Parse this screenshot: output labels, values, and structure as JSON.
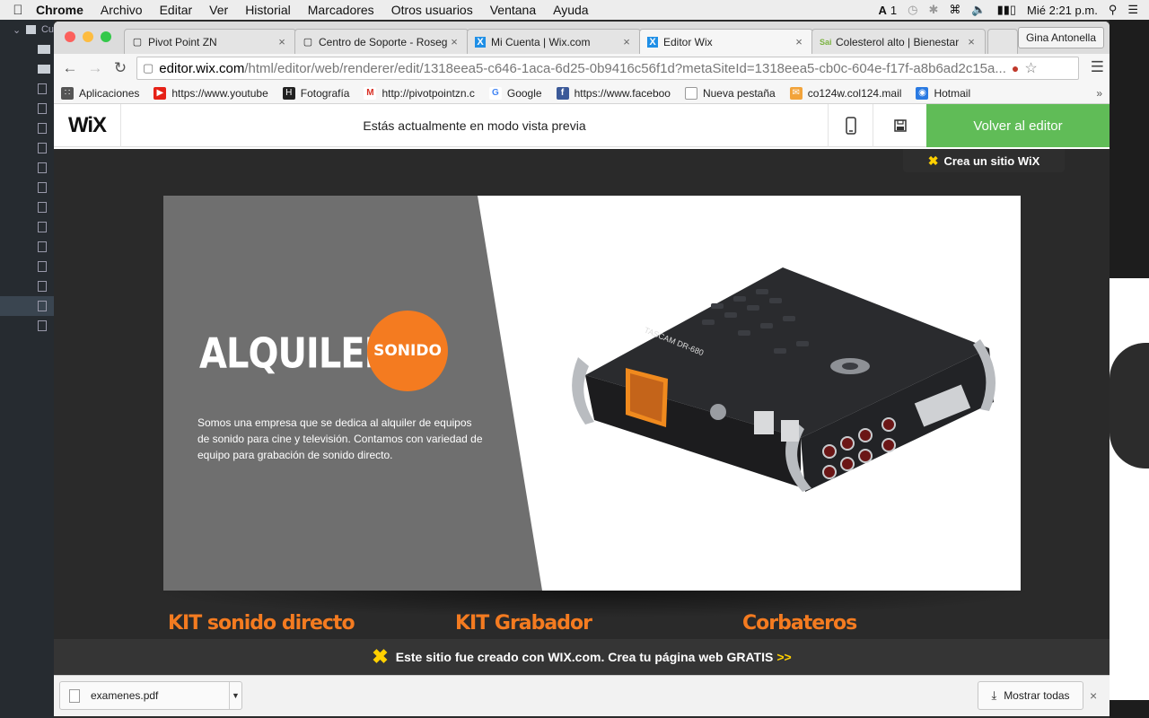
{
  "menubar": {
    "app": "Chrome",
    "items": [
      "Archivo",
      "Editar",
      "Ver",
      "Historial",
      "Marcadores",
      "Otros usuarios",
      "Ventana",
      "Ayuda"
    ],
    "status_a": "1",
    "clock": "Mié 2:21 p.m."
  },
  "sidebar_label": "Cu",
  "tabs": [
    {
      "title": "Pivot Point ZN",
      "icon": "page-icon"
    },
    {
      "title": "Centro de Soporte - Roseg",
      "icon": "page-icon"
    },
    {
      "title": "Mi Cuenta | Wix.com",
      "icon": "wix-icon"
    },
    {
      "title": "Editor Wix",
      "icon": "wix-icon",
      "active": true
    },
    {
      "title": "Colesterol alto | Bienestar",
      "icon": "sai-icon"
    }
  ],
  "profile": "Gina Antonella",
  "omnibox": {
    "host": "editor.wix.com",
    "path": "/html/editor/web/renderer/edit/1318eea5-c646-1aca-6d25-0b9416c56f1d?metaSiteId=1318eea5-cb0c-604e-f17f-a8b6ad2c15a..."
  },
  "bookmarks": [
    {
      "label": "Aplicaciones",
      "color": "#555555"
    },
    {
      "label": "https://www.youtube",
      "color": "#e62117"
    },
    {
      "label": "Fotografía",
      "color": "#222222"
    },
    {
      "label": "http://pivotpointzn.c",
      "color": "#d93025"
    },
    {
      "label": "Google",
      "color": "#4285f4"
    },
    {
      "label": "https://www.faceboo",
      "color": "#3b5998"
    },
    {
      "label": "Nueva pestaña",
      "color": "#bbbbbb"
    },
    {
      "label": "co124w.col124.mail",
      "color": "#f2a33a"
    },
    {
      "label": "Hotmail",
      "color": "#2a7ae2"
    }
  ],
  "wix": {
    "logo": "WiX",
    "preview_text": "Estás actualmente en modo vista previa",
    "back_button": "Volver al editor",
    "crea_sitio": "Crea un sitio WiX"
  },
  "hero": {
    "title": "ALQUILER",
    "badge": "SONIDO",
    "description": "Somos una empresa que se dedica al alquiler de equipos de sonido para cine y televisión. Contamos con variedad de equipo para grabación de sonido directo.",
    "device_brand": "TASCAM DR-680"
  },
  "kits": [
    "KIT sonido directo",
    "KIT Grabador",
    "Corbateros"
  ],
  "footer_banner": {
    "text": "Este sitio fue creado con WIX.com. Crea tu página web GRATIS",
    "arrows": ">>"
  },
  "downloads": {
    "file": "examenes.pdf",
    "show_all": "Mostrar todas"
  },
  "colors": {
    "accent_orange": "#f47b20",
    "wix_green": "#60bc57",
    "hero_gray": "#6f6f6f",
    "wix_yellow": "#ffd000"
  }
}
